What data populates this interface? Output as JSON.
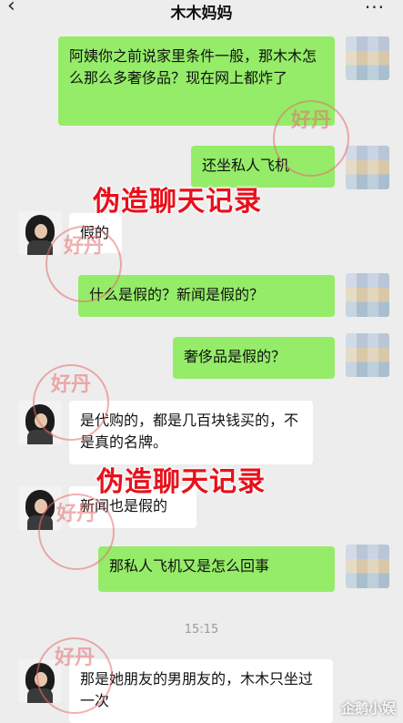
{
  "header": {
    "back_icon": "chevron-left-icon",
    "back_glyph": "‹",
    "title": "木木妈妈",
    "more_glyph": "···"
  },
  "messages": [
    {
      "from": "me",
      "text": "阿姨你之前说家里条件一般，那木木怎么那么多奢侈品？现在网上都炸了"
    },
    {
      "from": "me",
      "text": "还坐私人飞机"
    },
    {
      "from": "other",
      "text": "假的"
    },
    {
      "from": "me",
      "text": "什么是假的？新闻是假的？"
    },
    {
      "from": "me",
      "text": "奢侈品是假的？"
    },
    {
      "from": "other",
      "text": "是代购的，都是几百块钱买的，不是真的名牌。"
    },
    {
      "from": "other",
      "text": "新闻也是假的"
    },
    {
      "from": "me",
      "text": "那私人飞机又是怎么回事"
    },
    {
      "from": "other",
      "text": "那是她朋友的男朋友的，木木只坐过一次"
    }
  ],
  "timestamp": "15:15",
  "overlay_text": "伪造聊天记录",
  "watermark_text": "好丹",
  "corner_watermark": "企鹅小娱",
  "colors": {
    "sent_bubble": "#95ec69",
    "received_bubble": "#ffffff",
    "overlay": "#e8101a"
  }
}
